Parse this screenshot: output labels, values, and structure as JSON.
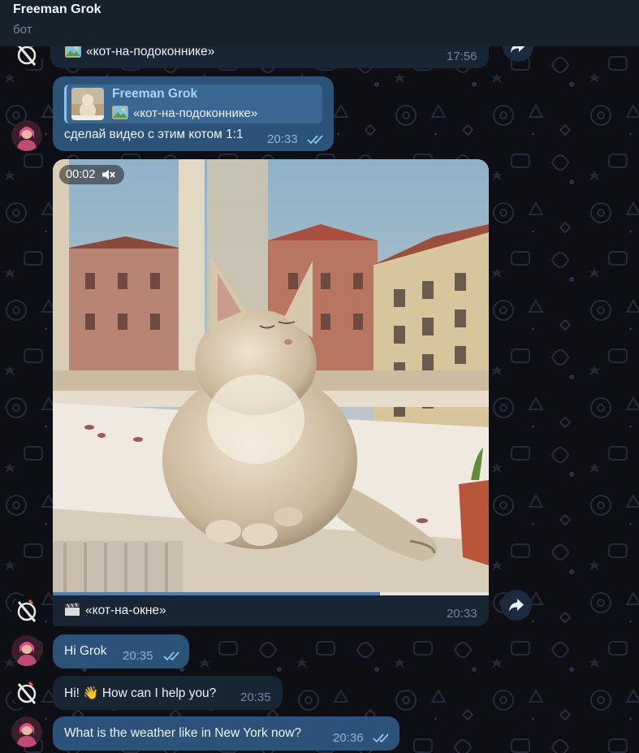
{
  "header": {
    "title": "Freeman Grok",
    "subtitle": "бот"
  },
  "messages": {
    "m1": {
      "text": "«кот-на-подоконнике»",
      "time": "17:56"
    },
    "m2": {
      "reply_name": "Freeman Grok",
      "reply_text": "«кот-на-подоконнике»",
      "text": "сделай видео с этим котом 1:1",
      "time": "20:33"
    },
    "m3": {
      "duration": "00:02",
      "caption": "«кот-на-окне»",
      "time": "20:33",
      "progress": 0.75
    },
    "m4": {
      "text": "Hi Grok",
      "time": "20:35"
    },
    "m5": {
      "text": "Hi! 👋 How can I help you?",
      "time": "20:35"
    },
    "m6": {
      "text": "What is the weather like in New York now?",
      "time": "20:36"
    }
  },
  "colors": {
    "incoming_bubble": "#182533",
    "outgoing_bubble": "#2b5278",
    "header": "#17212b",
    "accent": "#6ab3f3"
  },
  "icons": [
    "bot-avatar-icon",
    "user-avatar",
    "forward-icon",
    "photo-icon",
    "clapper-icon",
    "mute-icon",
    "double-check-icon"
  ]
}
